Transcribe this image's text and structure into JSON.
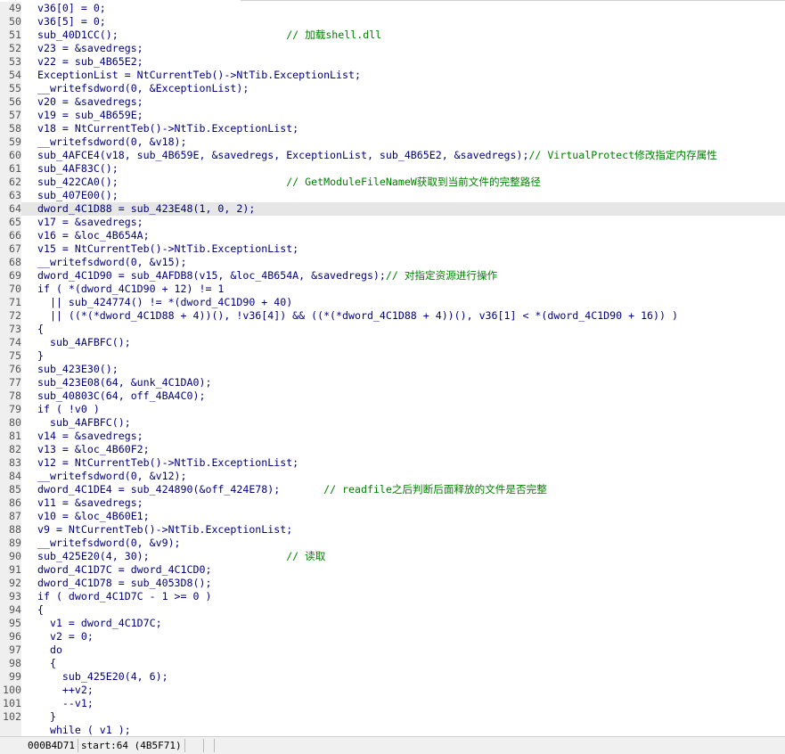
{
  "lines": [
    {
      "n": "49",
      "code": "v36[0] = 0;"
    },
    {
      "n": "50",
      "code": "v36[5] = 0;"
    },
    {
      "n": "51",
      "code": "sub_40D1CC();                           ",
      "comment": "// 加载shell.dll"
    },
    {
      "n": "52",
      "code": "v23 = &savedregs;"
    },
    {
      "n": "53",
      "code": "v22 = sub_4B65E2;"
    },
    {
      "n": "54",
      "code": "ExceptionList = NtCurrentTeb()->NtTib.ExceptionList;"
    },
    {
      "n": "55",
      "code": "__writefsdword(0, &ExceptionList);"
    },
    {
      "n": "56",
      "code": "v20 = &savedregs;"
    },
    {
      "n": "57",
      "code": "v19 = sub_4B659E;"
    },
    {
      "n": "58",
      "code": "v18 = NtCurrentTeb()->NtTib.ExceptionList;"
    },
    {
      "n": "59",
      "code": "__writefsdword(0, &v18);"
    },
    {
      "n": "60",
      "code": "sub_4AFCE4(v18, sub_4B659E, &savedregs, ExceptionList, sub_4B65E2, &savedregs);",
      "comment": "// VirtualProtect修改指定内存属性"
    },
    {
      "n": "61",
      "code": "sub_4AF83C();"
    },
    {
      "n": "62",
      "code": "sub_422CA0();                           ",
      "comment": "// GetModuleFileNameW获取到当前文件的完整路径"
    },
    {
      "n": "63",
      "code": "sub_407E00();"
    },
    {
      "n": "64",
      "code": "dword_4C1D88 = sub_423E48(1, 0, 2);",
      "hl": true
    },
    {
      "n": "65",
      "code": "v17 = &savedregs;"
    },
    {
      "n": "66",
      "code": "v16 = &loc_4B654A;"
    },
    {
      "n": "67",
      "code": "v15 = NtCurrentTeb()->NtTib.ExceptionList;"
    },
    {
      "n": "68",
      "code": "__writefsdword(0, &v15);"
    },
    {
      "n": "69",
      "code": "dword_4C1D90 = sub_4AFDB8(v15, &loc_4B654A, &savedregs);",
      "comment": "// 对指定资源进行操作"
    },
    {
      "n": "70",
      "code": "if ( *(dword_4C1D90 + 12) != 1"
    },
    {
      "n": "71",
      "code": "  || sub_424774() != *(dword_4C1D90 + 40)"
    },
    {
      "n": "72",
      "code": "  || ((*(*dword_4C1D88 + 4))(), !v36[4]) && ((*(*dword_4C1D88 + 4))(), v36[1] < *(dword_4C1D90 + 16)) )"
    },
    {
      "n": "73",
      "code": "{"
    },
    {
      "n": "74",
      "code": "  sub_4AFBFC();"
    },
    {
      "n": "75",
      "code": "}"
    },
    {
      "n": "76",
      "code": "sub_423E30();"
    },
    {
      "n": "77",
      "code": "sub_423E08(64, &unk_4C1DA0);"
    },
    {
      "n": "78",
      "code": "sub_40803C(64, off_4BA4C0);"
    },
    {
      "n": "79",
      "code": "if ( !v0 )"
    },
    {
      "n": "80",
      "code": "  sub_4AFBFC();"
    },
    {
      "n": "81",
      "code": "v14 = &savedregs;"
    },
    {
      "n": "82",
      "code": "v13 = &loc_4B60F2;"
    },
    {
      "n": "83",
      "code": "v12 = NtCurrentTeb()->NtTib.ExceptionList;"
    },
    {
      "n": "84",
      "code": "__writefsdword(0, &v12);"
    },
    {
      "n": "85",
      "code": "dword_4C1DE4 = sub_424890(&off_424E78);       ",
      "comment": "// readfile之后判断后面释放的文件是否完整"
    },
    {
      "n": "86",
      "code": "v11 = &savedregs;"
    },
    {
      "n": "87",
      "code": "v10 = &loc_4B60E1;"
    },
    {
      "n": "88",
      "code": "v9 = NtCurrentTeb()->NtTib.ExceptionList;"
    },
    {
      "n": "89",
      "code": "__writefsdword(0, &v9);"
    },
    {
      "n": "90",
      "code": "sub_425E20(4, 30);                      ",
      "comment": "// 读取"
    },
    {
      "n": "91",
      "code": "dword_4C1D7C = dword_4C1CD0;"
    },
    {
      "n": "92",
      "code": "dword_4C1D78 = sub_4053D8();"
    },
    {
      "n": "93",
      "code": "if ( dword_4C1D7C - 1 >= 0 )"
    },
    {
      "n": "94",
      "code": "{"
    },
    {
      "n": "95",
      "code": "  v1 = dword_4C1D7C;"
    },
    {
      "n": "96",
      "code": "  v2 = 0;"
    },
    {
      "n": "97",
      "code": "  do"
    },
    {
      "n": "98",
      "code": "  {"
    },
    {
      "n": "99",
      "code": "    sub_425E20(4, 6);"
    },
    {
      "n": "100",
      "code": "    ++v2;"
    },
    {
      "n": "101",
      "code": "    --v1;"
    },
    {
      "n": "102",
      "code": "  }"
    },
    {
      "n": "",
      "code": "  while ( v1 );"
    }
  ],
  "status": {
    "address": "000B4D71",
    "position": "start:64 (4B5F71)"
  },
  "colors": {
    "code": "#000080",
    "comment": "#008000",
    "highlight": "#e6e6e6"
  }
}
